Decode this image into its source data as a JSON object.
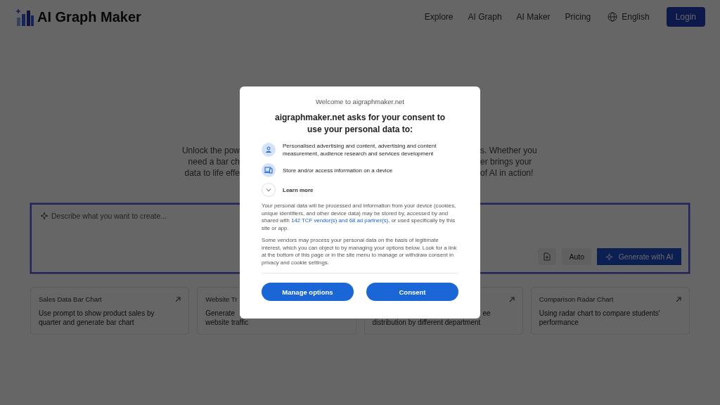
{
  "header": {
    "logo": "AI Graph Maker",
    "nav": [
      {
        "label": "Explore"
      },
      {
        "label": "AI Graph"
      },
      {
        "label": "AI Maker"
      },
      {
        "label": "Pricing"
      }
    ],
    "language": "English",
    "login": "Login"
  },
  "hero": {
    "lines": [
      {
        "left": "Unlock the pow",
        "right": "s. Whether you"
      },
      {
        "left": "need a bar ch",
        "right": "er brings your"
      },
      {
        "left": "data to life effe",
        "right": "of AI in action!"
      }
    ]
  },
  "prompt": {
    "placeholder": "Describe what you want to create...",
    "mode": "Auto",
    "generate": "Generate with AI"
  },
  "cards": [
    {
      "title": "Sales Data Bar Chart",
      "arrow": true,
      "lines": [
        {
          "kind": "line",
          "text": "Use prompt to show product sales by"
        },
        {
          "kind": "line",
          "text": "quarter and generate bar chart"
        }
      ]
    },
    {
      "title": "Website Tr",
      "arrow": false,
      "lines": [
        {
          "kind": "line",
          "text": "Generate"
        },
        {
          "kind": "line",
          "text": "website traffic"
        }
      ]
    },
    {
      "arrow": true,
      "lines": [
        {
          "kind": "tail",
          "text": "ee"
        },
        {
          "kind": "line",
          "text": "distribution by different department"
        }
      ]
    },
    {
      "title": "Comparison Radar Chart",
      "arrow": true,
      "lines": [
        {
          "kind": "line",
          "text": "Using radar chart to compare students'"
        },
        {
          "kind": "line",
          "text": "performance"
        }
      ]
    }
  ],
  "consent": {
    "welcome": "Welcome to aigraphmaker.net",
    "heading": "aigraphmaker.net asks for your consent to use your personal data to:",
    "purposes": [
      {
        "kind": "person",
        "text": "Personalised advertising and content, advertising and content measurement, audience research and services development"
      },
      {
        "kind": "device",
        "text": "Store and/or access information on a device"
      }
    ],
    "learn_more": {
      "label": "Learn more",
      "expanded": false
    },
    "notice": {
      "before": "Your personal data will be processed and information from your device (cookies, unique identifiers, and other device data) may be stored by, accessed by and shared with ",
      "link": "142 TCF vendor(s) and 68 ad partner(s)",
      "after": ", or used specifically by this site or app."
    },
    "legitimate": "Some vendors may process your personal data on the basis of legitimate interest, which you can object to by managing your options below. Look for a link at the bottom of this page or in the site menu to manage or withdraw consent in privacy and cookie settings.",
    "buttons": [
      "Manage options",
      "Consent"
    ]
  }
}
